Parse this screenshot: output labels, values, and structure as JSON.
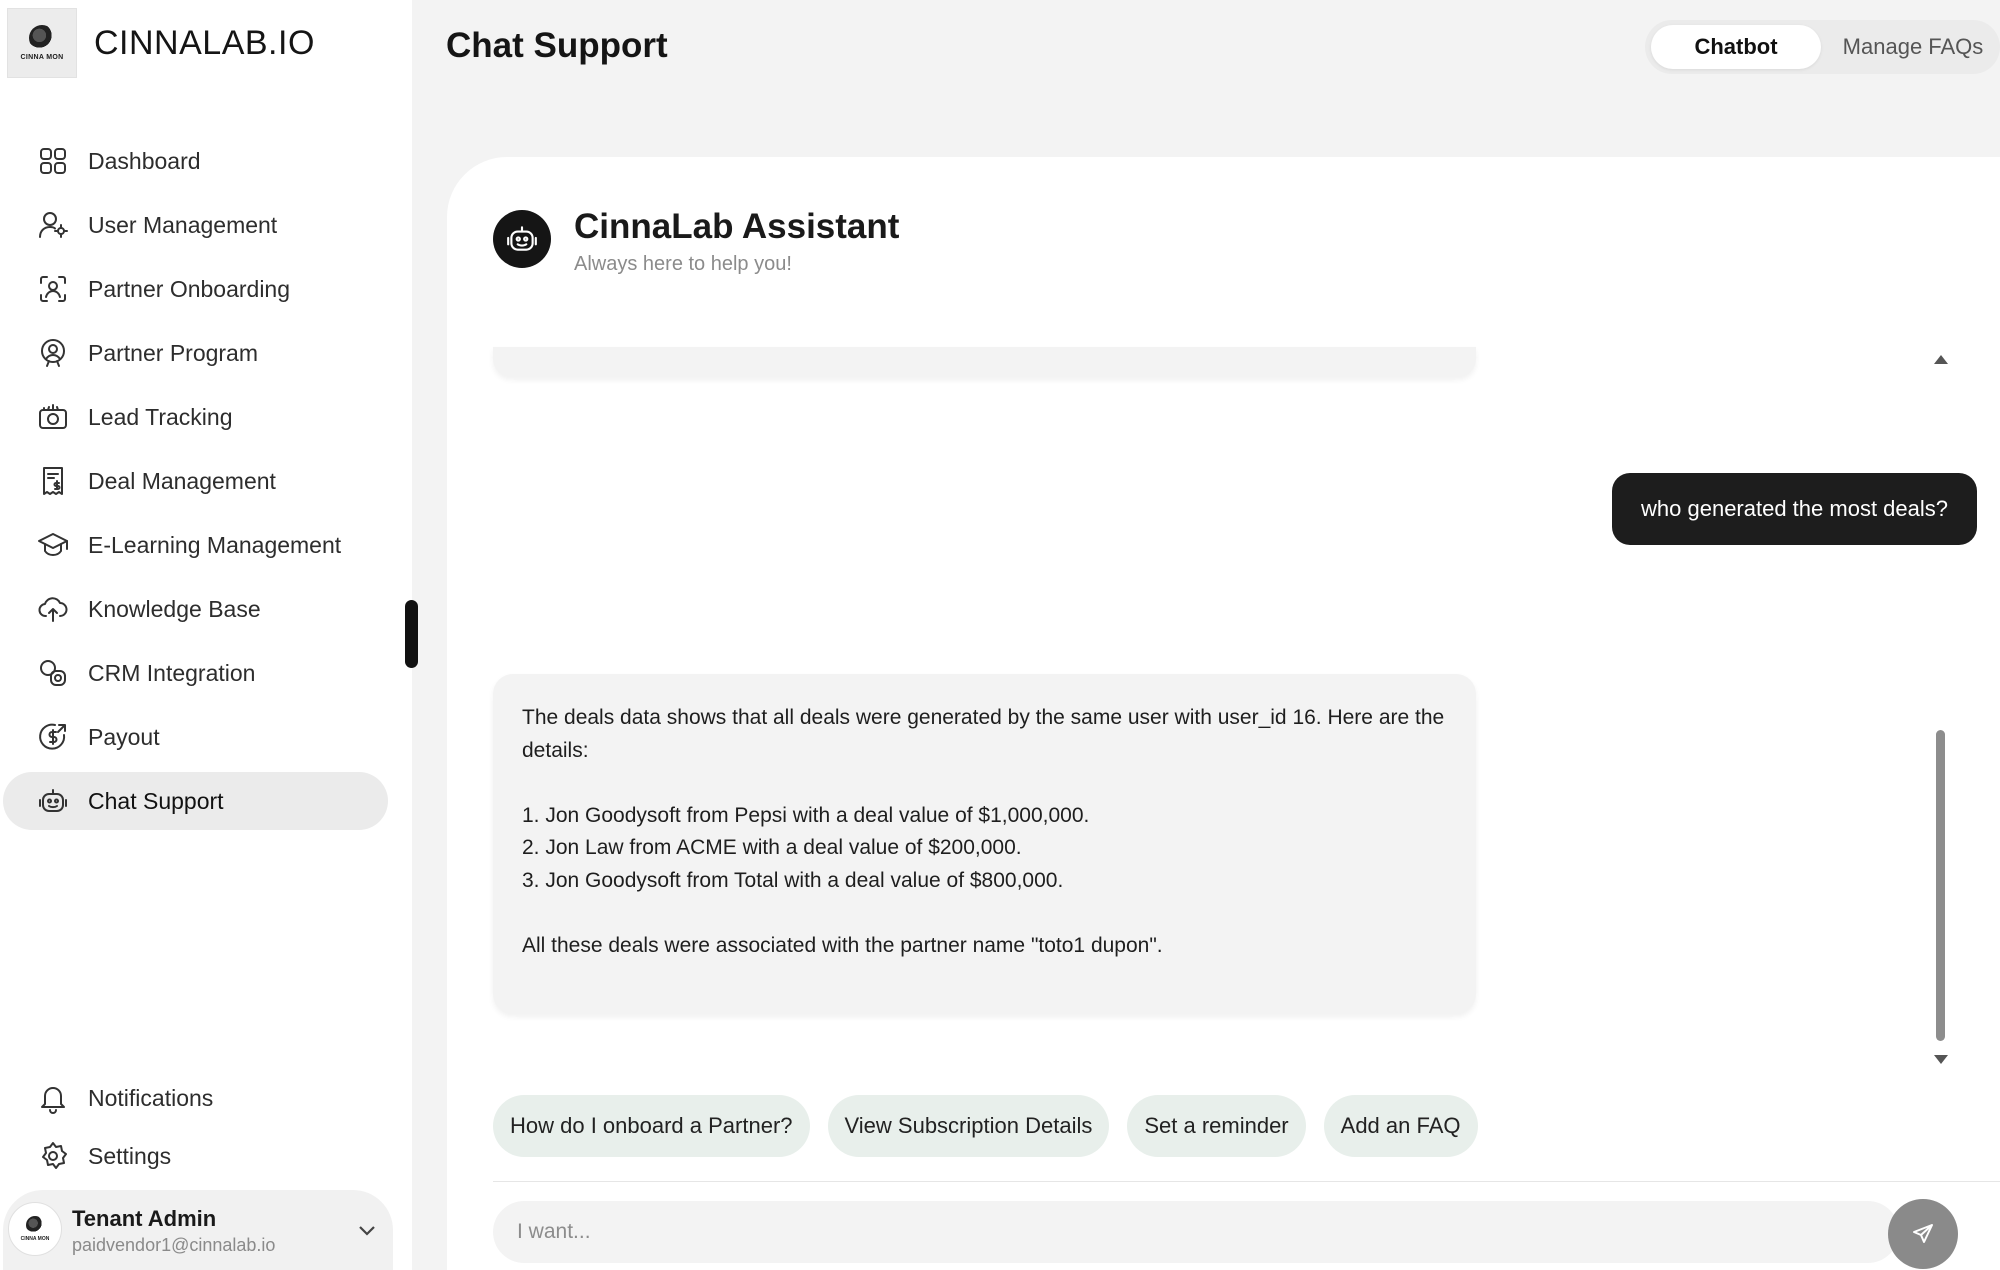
{
  "brand": {
    "name": "CINNALAB.IO",
    "logo_text": "CINNA MON"
  },
  "sidebar": {
    "items": [
      {
        "label": "Dashboard",
        "icon": "dashboard-icon"
      },
      {
        "label": "User Management",
        "icon": "user-gear-icon"
      },
      {
        "label": "Partner Onboarding",
        "icon": "face-scan-icon"
      },
      {
        "label": "Partner Program",
        "icon": "user-badge-icon"
      },
      {
        "label": "Lead Tracking",
        "icon": "camera-icon"
      },
      {
        "label": "Deal Management",
        "icon": "receipt-dollar-icon"
      },
      {
        "label": "E-Learning Management",
        "icon": "graduation-cap-icon"
      },
      {
        "label": "Knowledge Base",
        "icon": "cloud-upload-icon"
      },
      {
        "label": "CRM Integration",
        "icon": "crm-link-icon"
      },
      {
        "label": "Payout",
        "icon": "dollar-circle-icon"
      },
      {
        "label": "Chat Support",
        "icon": "robot-icon"
      }
    ],
    "active_index": 10,
    "bottom": [
      {
        "label": "Notifications",
        "icon": "bell-icon"
      },
      {
        "label": "Settings",
        "icon": "gear-icon"
      }
    ],
    "user": {
      "name": "Tenant Admin",
      "email": "paidvendor1@cinnalab.io",
      "avatar_text": "CINNA MON"
    }
  },
  "header": {
    "title": "Chat Support",
    "tabs": [
      {
        "label": "Chatbot",
        "active": true
      },
      {
        "label": "Manage FAQs",
        "active": false
      }
    ]
  },
  "assistant": {
    "name": "CinnaLab Assistant",
    "tagline": "Always here to help you!"
  },
  "messages": {
    "user": "who generated the most deals?",
    "bot_lines": [
      "The deals data shows that all deals were generated by the same user with user_id 16. Here are the details:",
      "",
      "1. Jon Goodysoft from Pepsi with a deal value of $1,000,000.",
      "2. Jon Law from ACME with a deal value of $200,000.",
      "3. Jon Goodysoft from Total with a deal value of $800,000.",
      "",
      "All these deals were associated with the partner name \"toto1 dupon\"."
    ]
  },
  "suggestions": [
    "How do I onboard a Partner?",
    "View Subscription Details",
    "Set a reminder",
    "Add an FAQ"
  ],
  "composer": {
    "placeholder": "I want...",
    "value": ""
  },
  "colors": {
    "accent_dark": "#1d1d1d",
    "chip_bg": "#e8efeb",
    "active_nav_bg": "#ebebeb"
  }
}
